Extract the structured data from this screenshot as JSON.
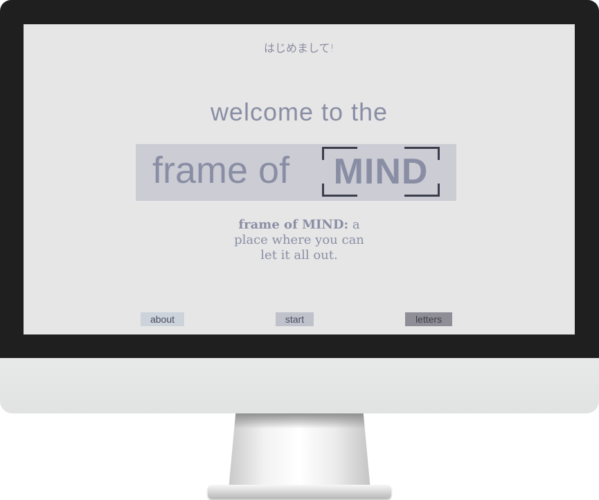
{
  "screen": {
    "greeting": "はじめまして!",
    "welcome": "welcome to the",
    "logo": {
      "frame_of": "frame of",
      "mind": "MIND"
    },
    "tagline": {
      "brand": "frame of MIND:",
      "line1_rest": " a",
      "line2": "place where you can",
      "line3": "let it all out."
    },
    "nav": {
      "about": "about",
      "start": "start",
      "letters": "letters"
    }
  },
  "colors": {
    "screen_bg": "#e6e6e6",
    "text": "#8a8ea4",
    "logo_bg": "#cbccd4",
    "frame_corners": "#3a3d4a",
    "about_bg": "#cdd3db",
    "start_bg": "#bfc1cb",
    "letters_bg": "#8f8e96"
  }
}
